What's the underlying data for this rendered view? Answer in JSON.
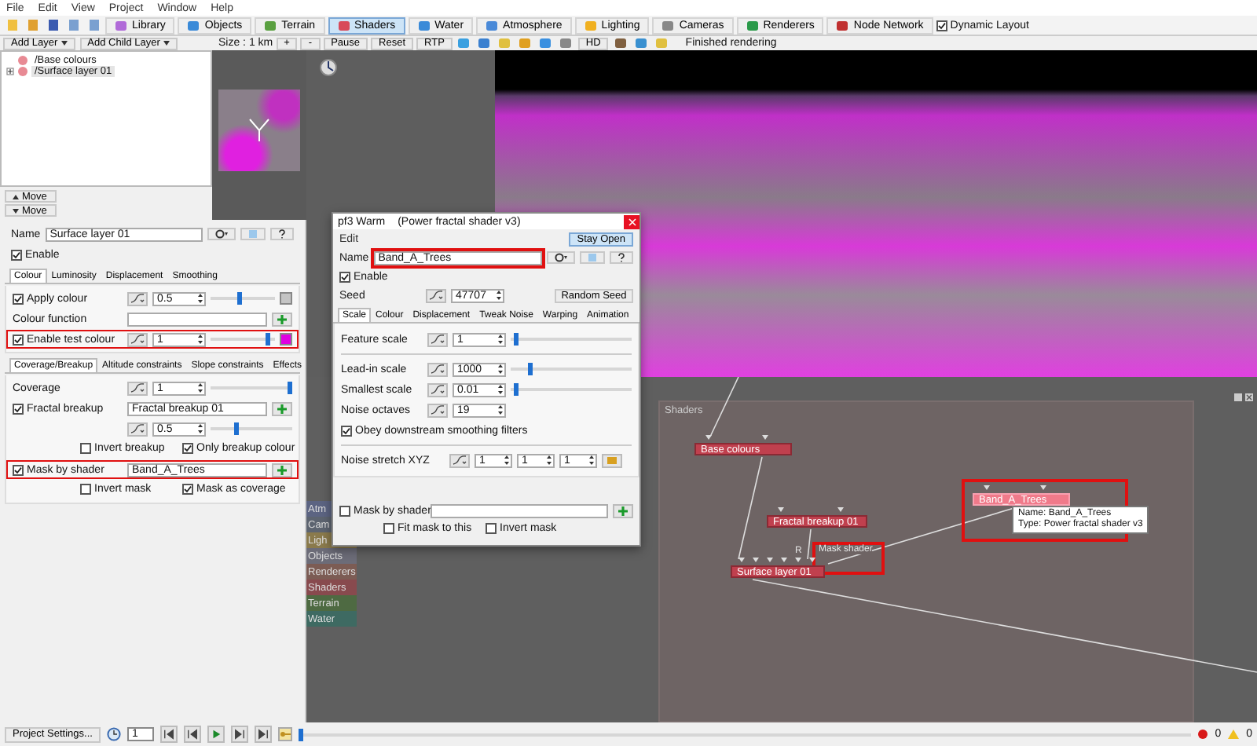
{
  "menu": [
    "File",
    "Edit",
    "View",
    "Project",
    "Window",
    "Help"
  ],
  "toolbar": {
    "buttons": [
      {
        "label": "Library",
        "selected": false
      },
      {
        "label": "Objects",
        "selected": false
      },
      {
        "label": "Terrain",
        "selected": false
      },
      {
        "label": "Shaders",
        "selected": true
      },
      {
        "label": "Water",
        "selected": false
      },
      {
        "label": "Atmosphere",
        "selected": false
      },
      {
        "label": "Lighting",
        "selected": false
      },
      {
        "label": "Cameras",
        "selected": false
      },
      {
        "label": "Renderers",
        "selected": false
      },
      {
        "label": "Node Network",
        "selected": false
      }
    ],
    "dynamic_layout": {
      "label": "Dynamic Layout",
      "checked": true
    }
  },
  "layers_panel": {
    "buttons": [
      "Add Layer",
      "Add Child Layer"
    ],
    "tree": [
      {
        "label": "/Base colours",
        "kind": "leaf"
      },
      {
        "label": "/Surface layer 01",
        "kind": "group",
        "expanded": false,
        "selected": true
      }
    ],
    "move_buttons": [
      "Move",
      "Move"
    ]
  },
  "render_toolbar": {
    "size": "Size : 1 km",
    "buttons": [
      "+",
      "-",
      "Pause",
      "Reset",
      "RTP"
    ],
    "hd": "HD",
    "status": "Finished rendering"
  },
  "settings": {
    "name_label": "Name",
    "name": "Surface layer 01",
    "enable": {
      "label": "Enable",
      "checked": true
    },
    "tabs": [
      {
        "label": "Colour",
        "selected": true
      },
      {
        "label": "Luminosity",
        "selected": false
      },
      {
        "label": "Displacement",
        "selected": false
      },
      {
        "label": "Smoothing",
        "selected": false
      }
    ],
    "colour_rows": [
      {
        "kind": "check_number",
        "label": "Apply colour",
        "checked": true,
        "value": "0.5",
        "level": 0.45,
        "color": "#c4c4c4",
        "highlighted": false
      },
      {
        "kind": "link",
        "label": "Colour function",
        "highlighted": false
      },
      {
        "kind": "check_number",
        "label": "Enable test colour",
        "checked": true,
        "value": "1",
        "level": 0.93,
        "color": "#e000e0",
        "highlighted": true
      }
    ],
    "tabs2": [
      {
        "label": "Coverage/Breakup",
        "selected": true
      },
      {
        "label": "Altitude constraints",
        "selected": false
      },
      {
        "label": "Slope constraints",
        "selected": false
      },
      {
        "label": "Effects",
        "selected": false
      }
    ],
    "coverage_rows": [
      {
        "kind": "number",
        "label": "Coverage",
        "value": "1",
        "level": 1
      },
      {
        "kind": "check_link",
        "label": "Fractal breakup",
        "checked": true,
        "value": "Fractal breakup 01",
        "highlighted": false
      },
      {
        "kind": "sub_number",
        "value": "0.5",
        "level": 0.3
      },
      {
        "kind": "options",
        "options": [
          {
            "label": "Invert breakup",
            "checked": false
          },
          {
            "label": "Only breakup colour",
            "checked": true
          }
        ]
      },
      {
        "kind": "check_link",
        "label": "Mask by shader",
        "checked": true,
        "value": "Band_A_Trees",
        "highlighted": true
      },
      {
        "kind": "options",
        "options": [
          {
            "label": "Invert mask",
            "checked": false
          },
          {
            "label": "Mask as coverage",
            "checked": true
          }
        ]
      }
    ]
  },
  "dialog": {
    "title": "pf3 Warm",
    "subtitle": "(Power fractal shader v3)",
    "menu": "Edit",
    "stay_open": "Stay Open",
    "name_label": "Name",
    "name": "Band_A_Trees",
    "name_highlighted": true,
    "enable": {
      "label": "Enable",
      "checked": true
    },
    "seed_label": "Seed",
    "seed": "47707",
    "random_seed": "Random Seed",
    "tabs": [
      {
        "label": "Scale",
        "selected": true
      },
      {
        "label": "Colour",
        "selected": false
      },
      {
        "label": "Displacement",
        "selected": false
      },
      {
        "label": "Tweak Noise",
        "selected": false
      },
      {
        "label": "Warping",
        "selected": false
      },
      {
        "label": "Animation",
        "selected": false
      }
    ],
    "groups": [
      [
        {
          "kind": "number",
          "label": "Feature scale",
          "value": "1",
          "level": 0.03
        }
      ],
      [
        {
          "kind": "number",
          "label": "Lead-in scale",
          "value": "1000",
          "level": 0.15
        },
        {
          "kind": "number",
          "label": "Smallest scale",
          "value": "0.01",
          "level": 0.03
        },
        {
          "kind": "plain_number",
          "label": "Noise octaves",
          "value": "19"
        },
        {
          "kind": "check",
          "label": "Obey downstream smoothing filters",
          "checked": true
        }
      ],
      [
        {
          "kind": "xyz",
          "label": "Noise stretch XYZ",
          "values": [
            "1",
            "1",
            "1"
          ]
        }
      ]
    ],
    "mask_rows": [
      {
        "kind": "check_link",
        "label": "Mask by shader",
        "checked": false,
        "highlighted": false
      },
      {
        "kind": "options",
        "options": [
          {
            "label": "Fit mask to this",
            "checked": false
          },
          {
            "label": "Invert mask",
            "checked": false
          }
        ]
      }
    ]
  },
  "node_network": {
    "categories": [
      {
        "label": "Atm",
        "color": "#5c6482"
      },
      {
        "label": "Cam",
        "color": "#5d6470"
      },
      {
        "label": "Ligh",
        "color": "#8a7a4c"
      },
      {
        "label": "Objects",
        "color": "#6c6c78"
      },
      {
        "label": "Renderers",
        "color": "#7c5c54"
      },
      {
        "label": "Shaders",
        "color": "#884a4e"
      },
      {
        "label": "Terrain",
        "color": "#4e6a42"
      },
      {
        "label": "Water",
        "color": "#3e6a62"
      }
    ],
    "group_title": "Shaders",
    "nodes": [
      {
        "label": "Base colours",
        "kind": "shader",
        "selected": false,
        "highlighted": false
      },
      {
        "label": "Fractal breakup 01",
        "kind": "shader",
        "selected": false,
        "highlighted": false
      },
      {
        "label": "Surface layer 01",
        "kind": "layer",
        "selected": false,
        "highlighted": false
      },
      {
        "label": "Band_A_Trees",
        "kind": "shader",
        "selected": true,
        "highlighted": true
      }
    ],
    "port_labels": [
      "R",
      "Mask shader"
    ],
    "port_highlighted": true,
    "tooltip": [
      "Name: Band_A_Trees",
      "Type: Power fractal shader v3"
    ]
  },
  "status_bar": {
    "project_settings": "Project Settings...",
    "frame": "1",
    "timeline": {
      "level": 0
    },
    "errors": "0",
    "warnings": "0"
  }
}
